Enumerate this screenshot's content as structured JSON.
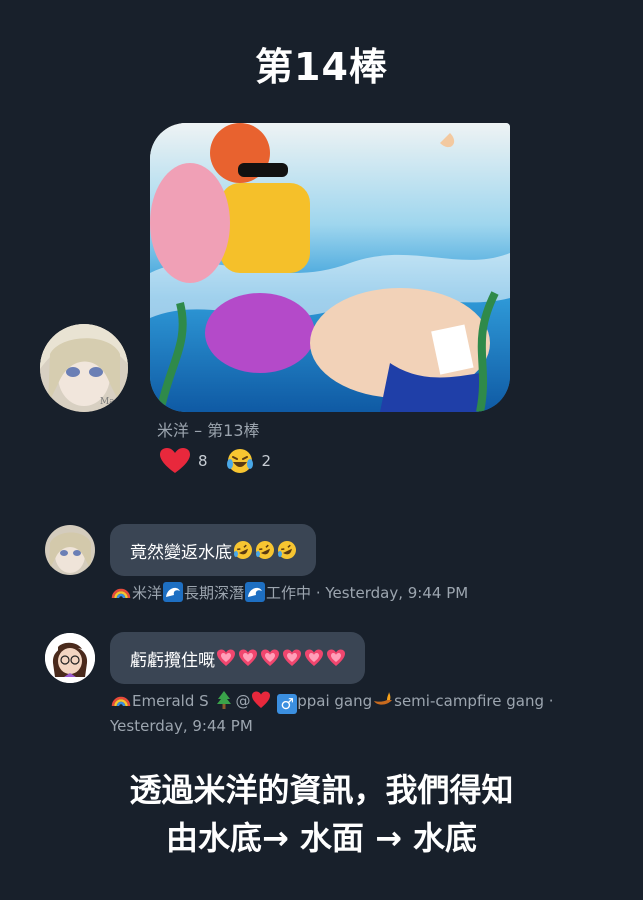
{
  "title": "第14棒",
  "post": {
    "caption": "米洋 – 第13棒",
    "reactions": [
      {
        "icon": "heart-icon",
        "count": "8"
      },
      {
        "icon": "laughing-tears-icon",
        "count": "2"
      }
    ]
  },
  "comments": [
    {
      "text": "竟然變返水底",
      "text_emojis": [
        "rofl-emoji",
        "rofl-emoji",
        "rofl-emoji"
      ],
      "author": "米洋",
      "author_prefix_emoji": "rainbow-emoji",
      "roles": [
        "長期深潛",
        "工作中"
      ],
      "role_emoji": "wave-emoji",
      "separator": "·",
      "timestamp": "Yesterday, 9:44 PM"
    },
    {
      "text": "虧虧攬住嘅",
      "text_emojis": [
        "heart-emoji",
        "heart-emoji",
        "heart-emoji",
        "heart-emoji",
        "heart-emoji",
        "heart-emoji"
      ],
      "author": "Emerald S",
      "author_prefix_emoji": "rainbow-emoji",
      "at_sign": "@",
      "male_symbol": "♂",
      "gang1": "ppai gang",
      "gang2": "semi-campfire gang",
      "separator": "·",
      "timestamp": "Yesterday, 9:44 PM"
    }
  ],
  "footer": {
    "line1": "透過米洋的資訊，我們得知",
    "line2": "由水底→ 水面 → 水底"
  },
  "colors": {
    "background": "#18202b",
    "bubble": "#3a4554",
    "heart": "#e8283c",
    "male_blue": "#3b8fe0"
  }
}
